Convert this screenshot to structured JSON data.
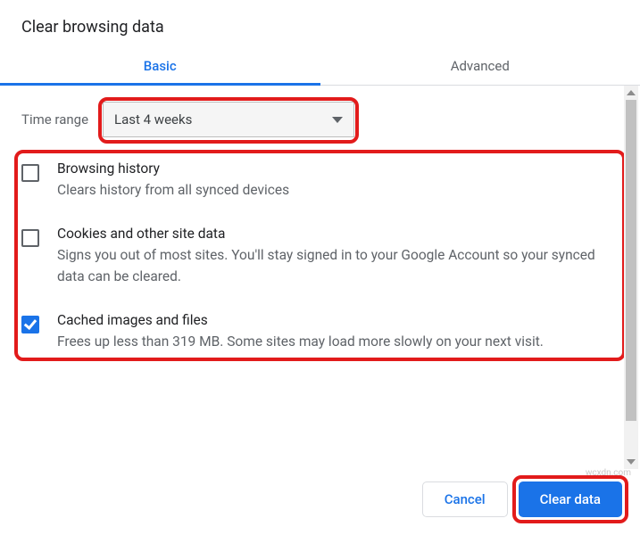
{
  "title": "Clear browsing data",
  "tabs": {
    "basic": "Basic",
    "advanced": "Advanced"
  },
  "timerange": {
    "label": "Time range",
    "value": "Last 4 weeks"
  },
  "options": [
    {
      "title": "Browsing history",
      "desc": "Clears history from all synced devices",
      "checked": false
    },
    {
      "title": "Cookies and other site data",
      "desc": "Signs you out of most sites. You'll stay signed in to your Google Account so your synced data can be cleared.",
      "checked": false
    },
    {
      "title": "Cached images and files",
      "desc": "Frees up less than 319 MB. Some sites may load more slowly on your next visit.",
      "checked": true
    }
  ],
  "buttons": {
    "cancel": "Cancel",
    "clear": "Clear data"
  },
  "watermark": "wcxdn.com"
}
